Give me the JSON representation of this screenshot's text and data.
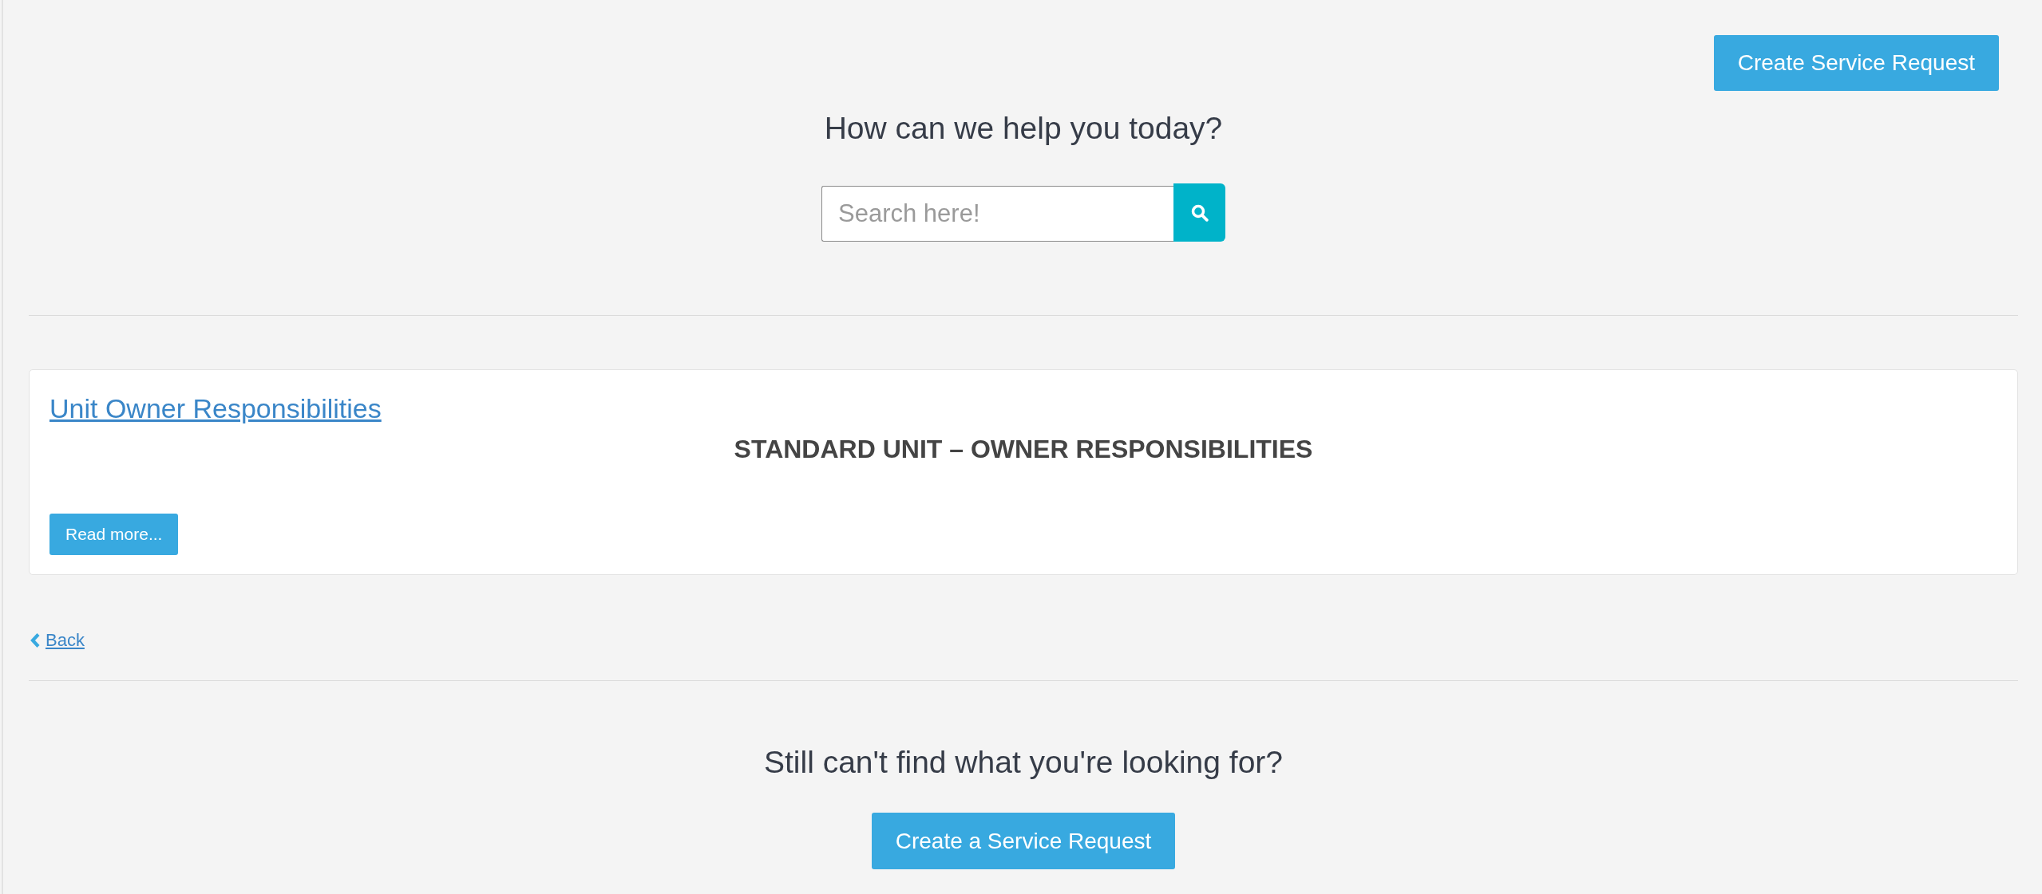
{
  "header_button": {
    "label": "Create Service Request"
  },
  "heading": "How can we help you today?",
  "search": {
    "placeholder": "Search here!"
  },
  "articles": [
    {
      "title": "Unit Owner Responsibilities",
      "summary": "STANDARD UNIT – OWNER RESPONSIBILITIES",
      "action": "Read more..."
    }
  ],
  "back_link": {
    "label": "Back"
  },
  "footer": {
    "heading": "Still can't find what you're looking for?",
    "button": "Create a Service Request"
  }
}
